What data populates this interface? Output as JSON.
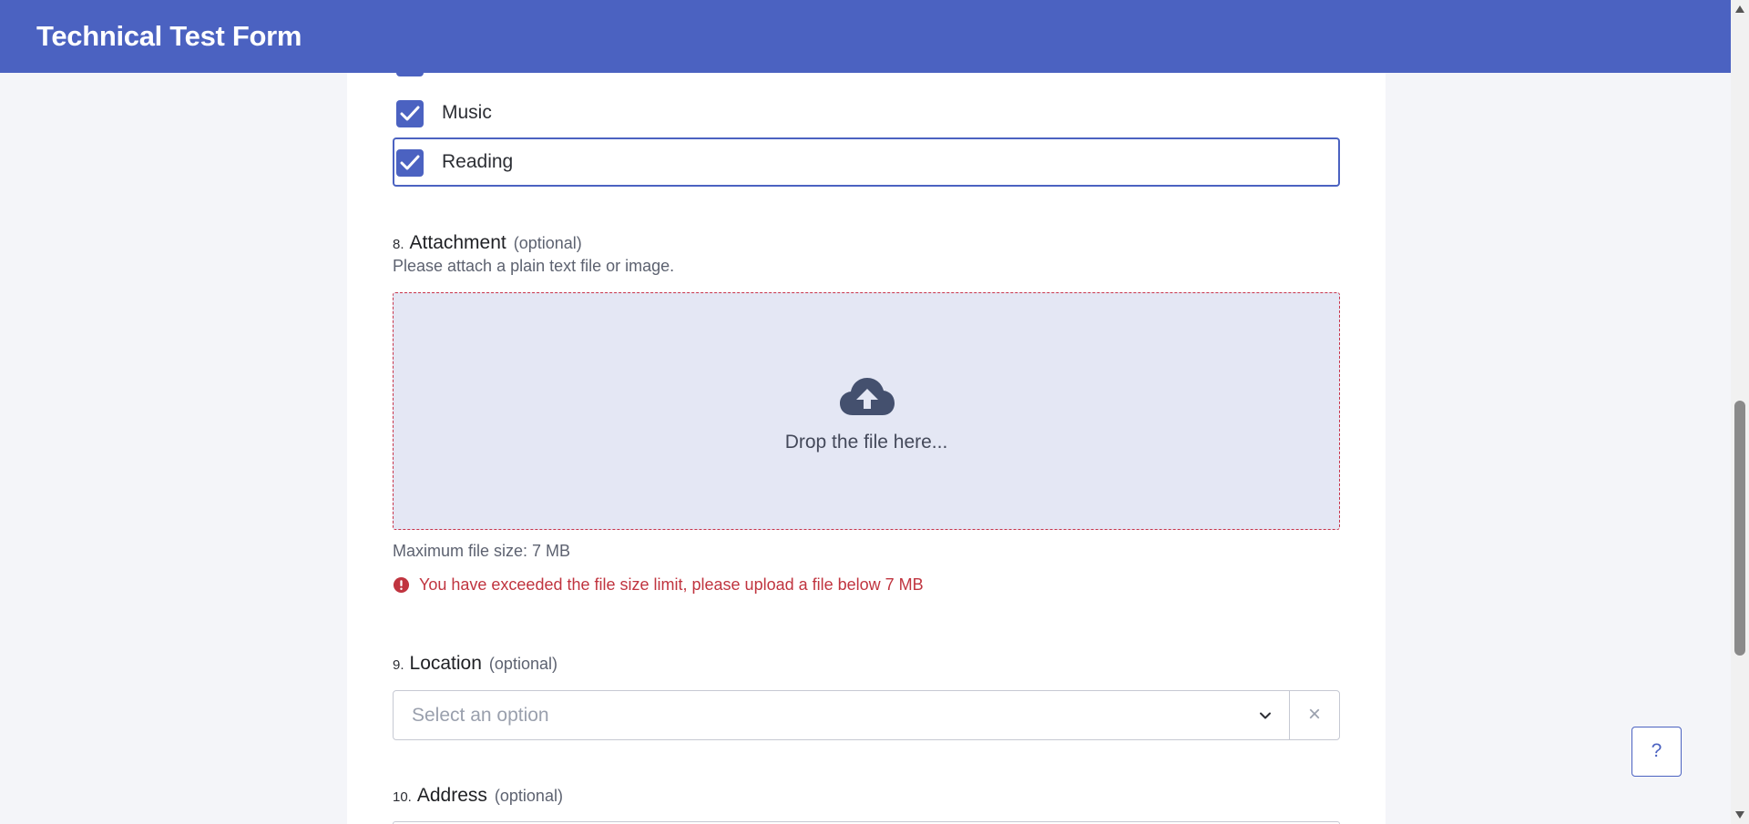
{
  "header": {
    "title": "Technical Test Form"
  },
  "interests": {
    "options": [
      {
        "label": "Music",
        "checked": true
      },
      {
        "label": "Reading",
        "checked": true
      }
    ]
  },
  "attachment": {
    "number": "8.",
    "title": "Attachment",
    "optional": "(optional)",
    "description": "Please attach a plain text file or image.",
    "drop_text": "Drop the file here...",
    "max_size": "Maximum file size: 7 MB",
    "error": "You have exceeded the file size limit, please upload a file below 7 MB"
  },
  "location": {
    "number": "9.",
    "title": "Location",
    "optional": "(optional)",
    "placeholder": "Select an option",
    "clear_label": "×"
  },
  "address": {
    "number": "10.",
    "title": "Address",
    "optional": "(optional)"
  },
  "help": {
    "label": "?"
  },
  "colors": {
    "accent": "#4b62c1",
    "error": "#c0343f",
    "dropzone_bg": "#e4e7f4"
  }
}
